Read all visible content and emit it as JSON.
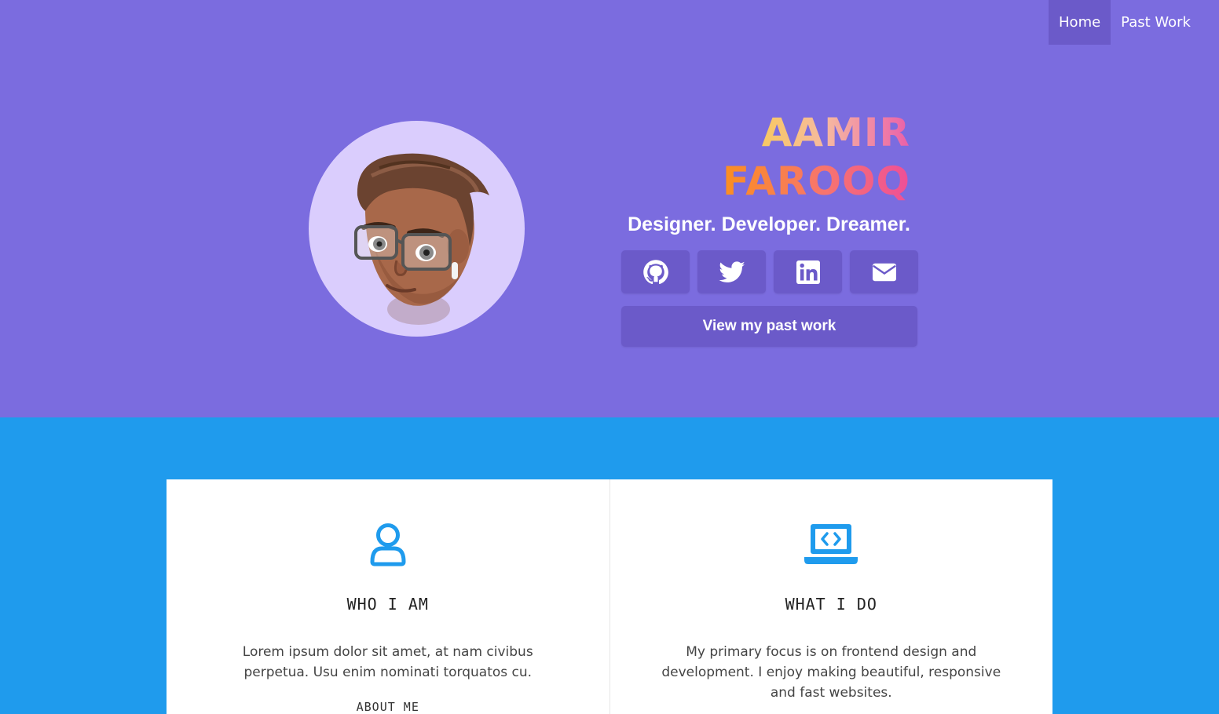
{
  "nav": {
    "items": [
      {
        "label": "Home",
        "active": true
      },
      {
        "label": "Past Work",
        "active": false
      }
    ]
  },
  "hero": {
    "name_line1": "AAMIR",
    "name_line2": "FAROOQ",
    "tagline": "Designer. Developer. Dreamer.",
    "socials": [
      {
        "icon": "github-icon"
      },
      {
        "icon": "twitter-icon"
      },
      {
        "icon": "linkedin-icon"
      },
      {
        "icon": "envelope-icon"
      }
    ],
    "cta_label": "View my past work",
    "colors": {
      "background": "#7b6cdf",
      "button": "#6b5ac9",
      "avatar_bg": "#dacdfd"
    }
  },
  "cards": [
    {
      "icon": "user-icon",
      "title": "WHO I AM",
      "text": "Lorem ipsum dolor sit amet, at nam civibus perpetua. Usu enim nominati torquatos cu.",
      "link": "ABOUT ME"
    },
    {
      "icon": "laptop-code-icon",
      "title": "WHAT I DO",
      "text": "My primary focus is on frontend design and development. I enjoy making beautiful, responsive and fast websites."
    }
  ],
  "colors": {
    "section_bg": "#1f9bed",
    "accent": "#1f9bed"
  }
}
